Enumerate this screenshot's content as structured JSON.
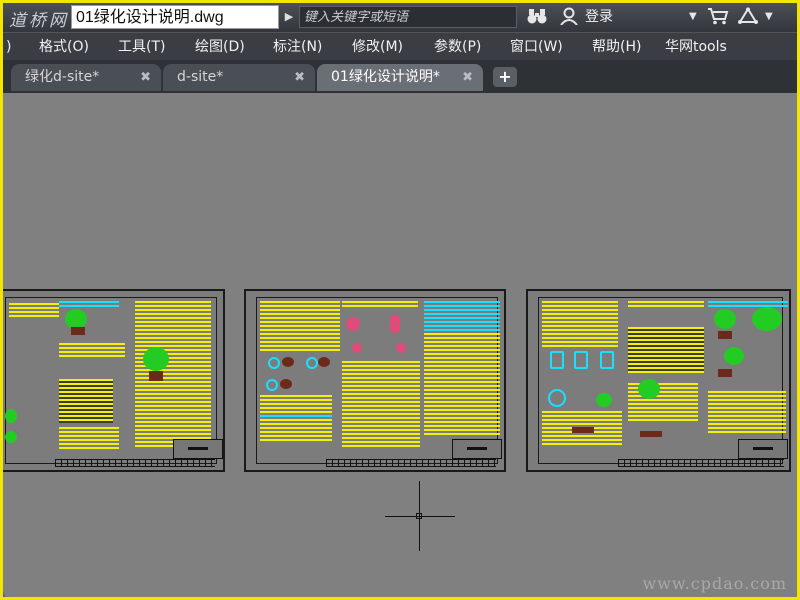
{
  "titlebar": {
    "logo_text": "道桥网",
    "filename": "01绿化设计说明.dwg",
    "search_placeholder": "键入关键字或短语",
    "login_label": "登录",
    "icons": [
      "binoculars-icon",
      "user-icon",
      "dropdown-icon",
      "cart-icon",
      "network-icon"
    ]
  },
  "menubar": {
    "items": [
      {
        "label": ")"
      },
      {
        "label": "格式(O)"
      },
      {
        "label": "工具(T)"
      },
      {
        "label": "绘图(D)"
      },
      {
        "label": "标注(N)"
      },
      {
        "label": "修改(M)"
      },
      {
        "label": "参数(P)"
      },
      {
        "label": "窗口(W)"
      },
      {
        "label": "帮助(H)"
      },
      {
        "label": "华网tools"
      }
    ]
  },
  "tabs": {
    "items": [
      {
        "label": "绿化d-site*",
        "active": false
      },
      {
        "label": "d-site*",
        "active": false
      },
      {
        "label": "01绿化设计说明*",
        "active": true
      }
    ],
    "close_glyph": "✖",
    "add_glyph": "+"
  },
  "canvas": {
    "watermark": "www.cpdao.com",
    "colors": {
      "background": "#808080",
      "text_yellow": "#f5f000",
      "text_cyan": "#19e0ff",
      "tree_green": "#22cc22",
      "accent_pink": "#e04c7a",
      "frame_border": "#f2e600"
    }
  }
}
